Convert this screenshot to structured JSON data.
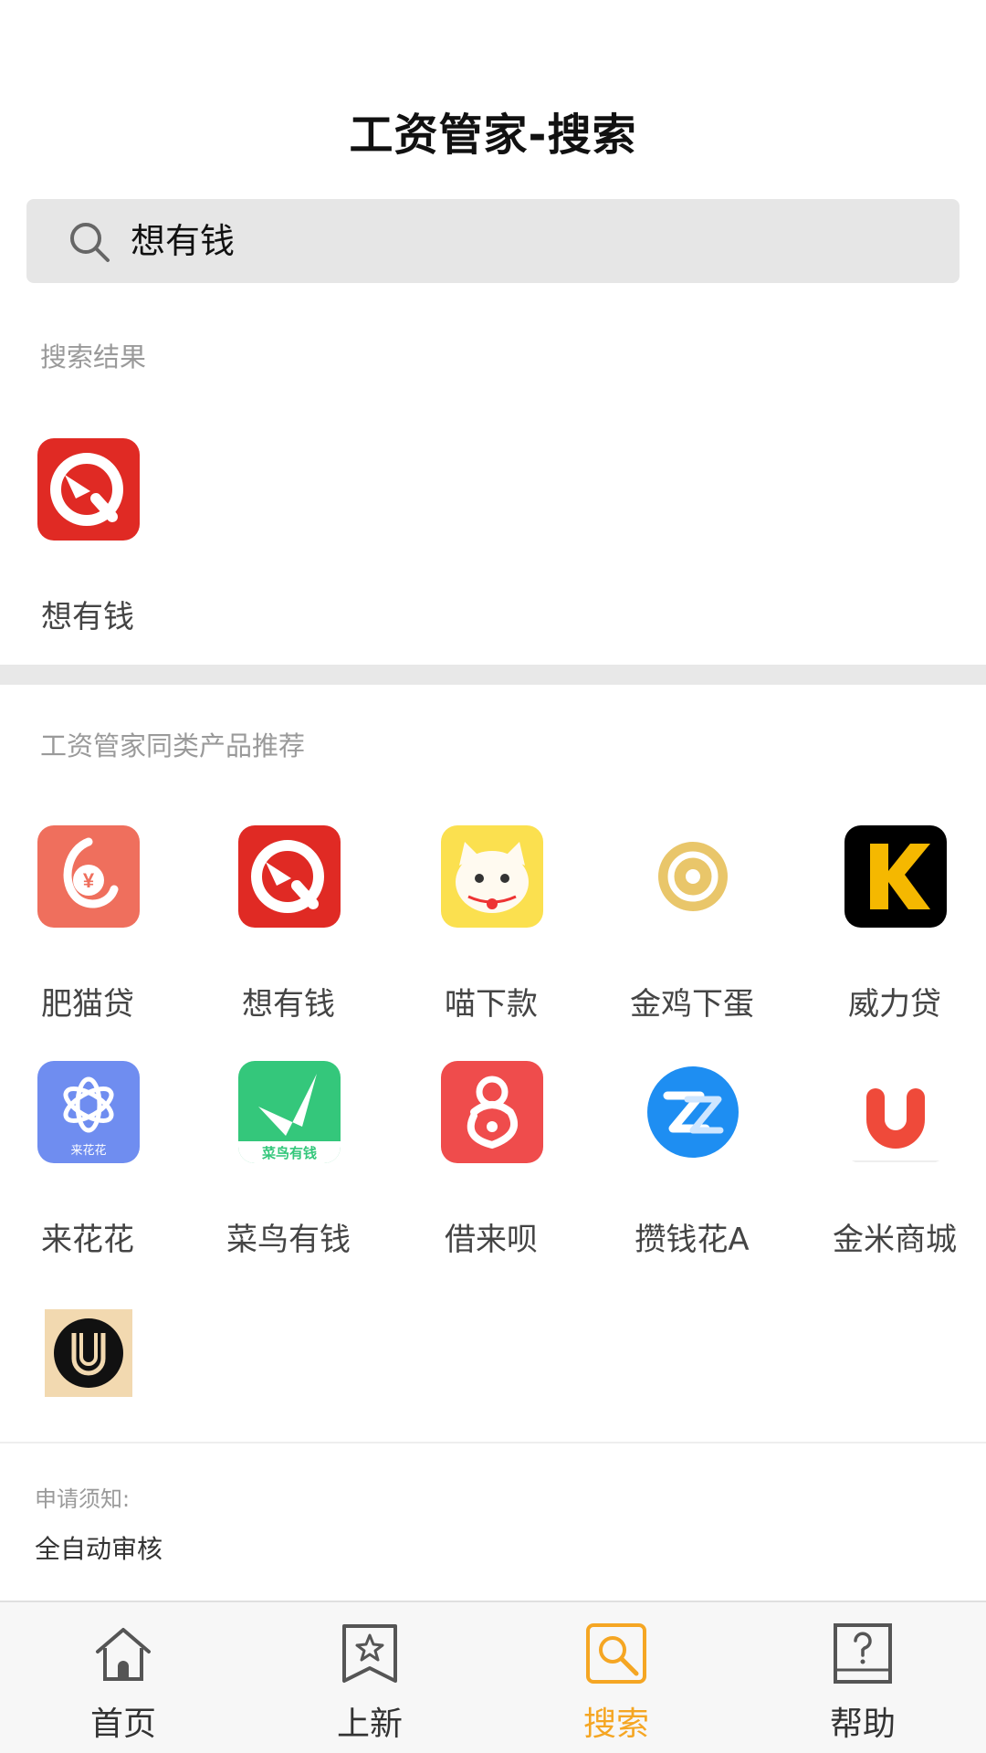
{
  "header": {
    "title": "工资管家-搜索"
  },
  "search": {
    "value": "想有钱"
  },
  "results": {
    "label": "搜索结果",
    "items": [
      {
        "name": "想有钱",
        "icon": "xiangyouqian-logo-icon"
      }
    ]
  },
  "recommend": {
    "label": "工资管家同类产品推荐",
    "items": [
      {
        "name": "肥猫贷",
        "icon": "feimaodai-logo-icon"
      },
      {
        "name": "想有钱",
        "icon": "xiangyouqian-logo-icon"
      },
      {
        "name": "喵下款",
        "icon": "miaoxiakuan-logo-icon"
      },
      {
        "name": "金鸡下蛋",
        "icon": "jinjixiadan-logo-icon"
      },
      {
        "name": "威力贷",
        "icon": "weilidai-logo-icon"
      },
      {
        "name": "来花花",
        "icon": "laihuahua-logo-icon"
      },
      {
        "name": "菜鸟有钱",
        "icon": "cainiaoyouqian-logo-icon"
      },
      {
        "name": "借来呗",
        "icon": "jielaibei-logo-icon"
      },
      {
        "name": "攒钱花A",
        "icon": "zanqianhua-logo-icon"
      },
      {
        "name": "金米商城",
        "icon": "jinmishangcheng-logo-icon"
      },
      {
        "name": "",
        "icon": "u-logo-icon"
      }
    ]
  },
  "notice": {
    "title": "申请须知:",
    "text": "全自动审核"
  },
  "tabbar": {
    "active_color": "#f5a623",
    "items": [
      {
        "label": "首页",
        "icon": "home-icon"
      },
      {
        "label": "上新",
        "icon": "new-star-icon"
      },
      {
        "label": "搜索",
        "icon": "search-icon",
        "active": true
      },
      {
        "label": "帮助",
        "icon": "help-icon"
      }
    ]
  },
  "icon_texts": {
    "laihuahua": "来花花",
    "cainiao": "菜鸟有钱"
  }
}
